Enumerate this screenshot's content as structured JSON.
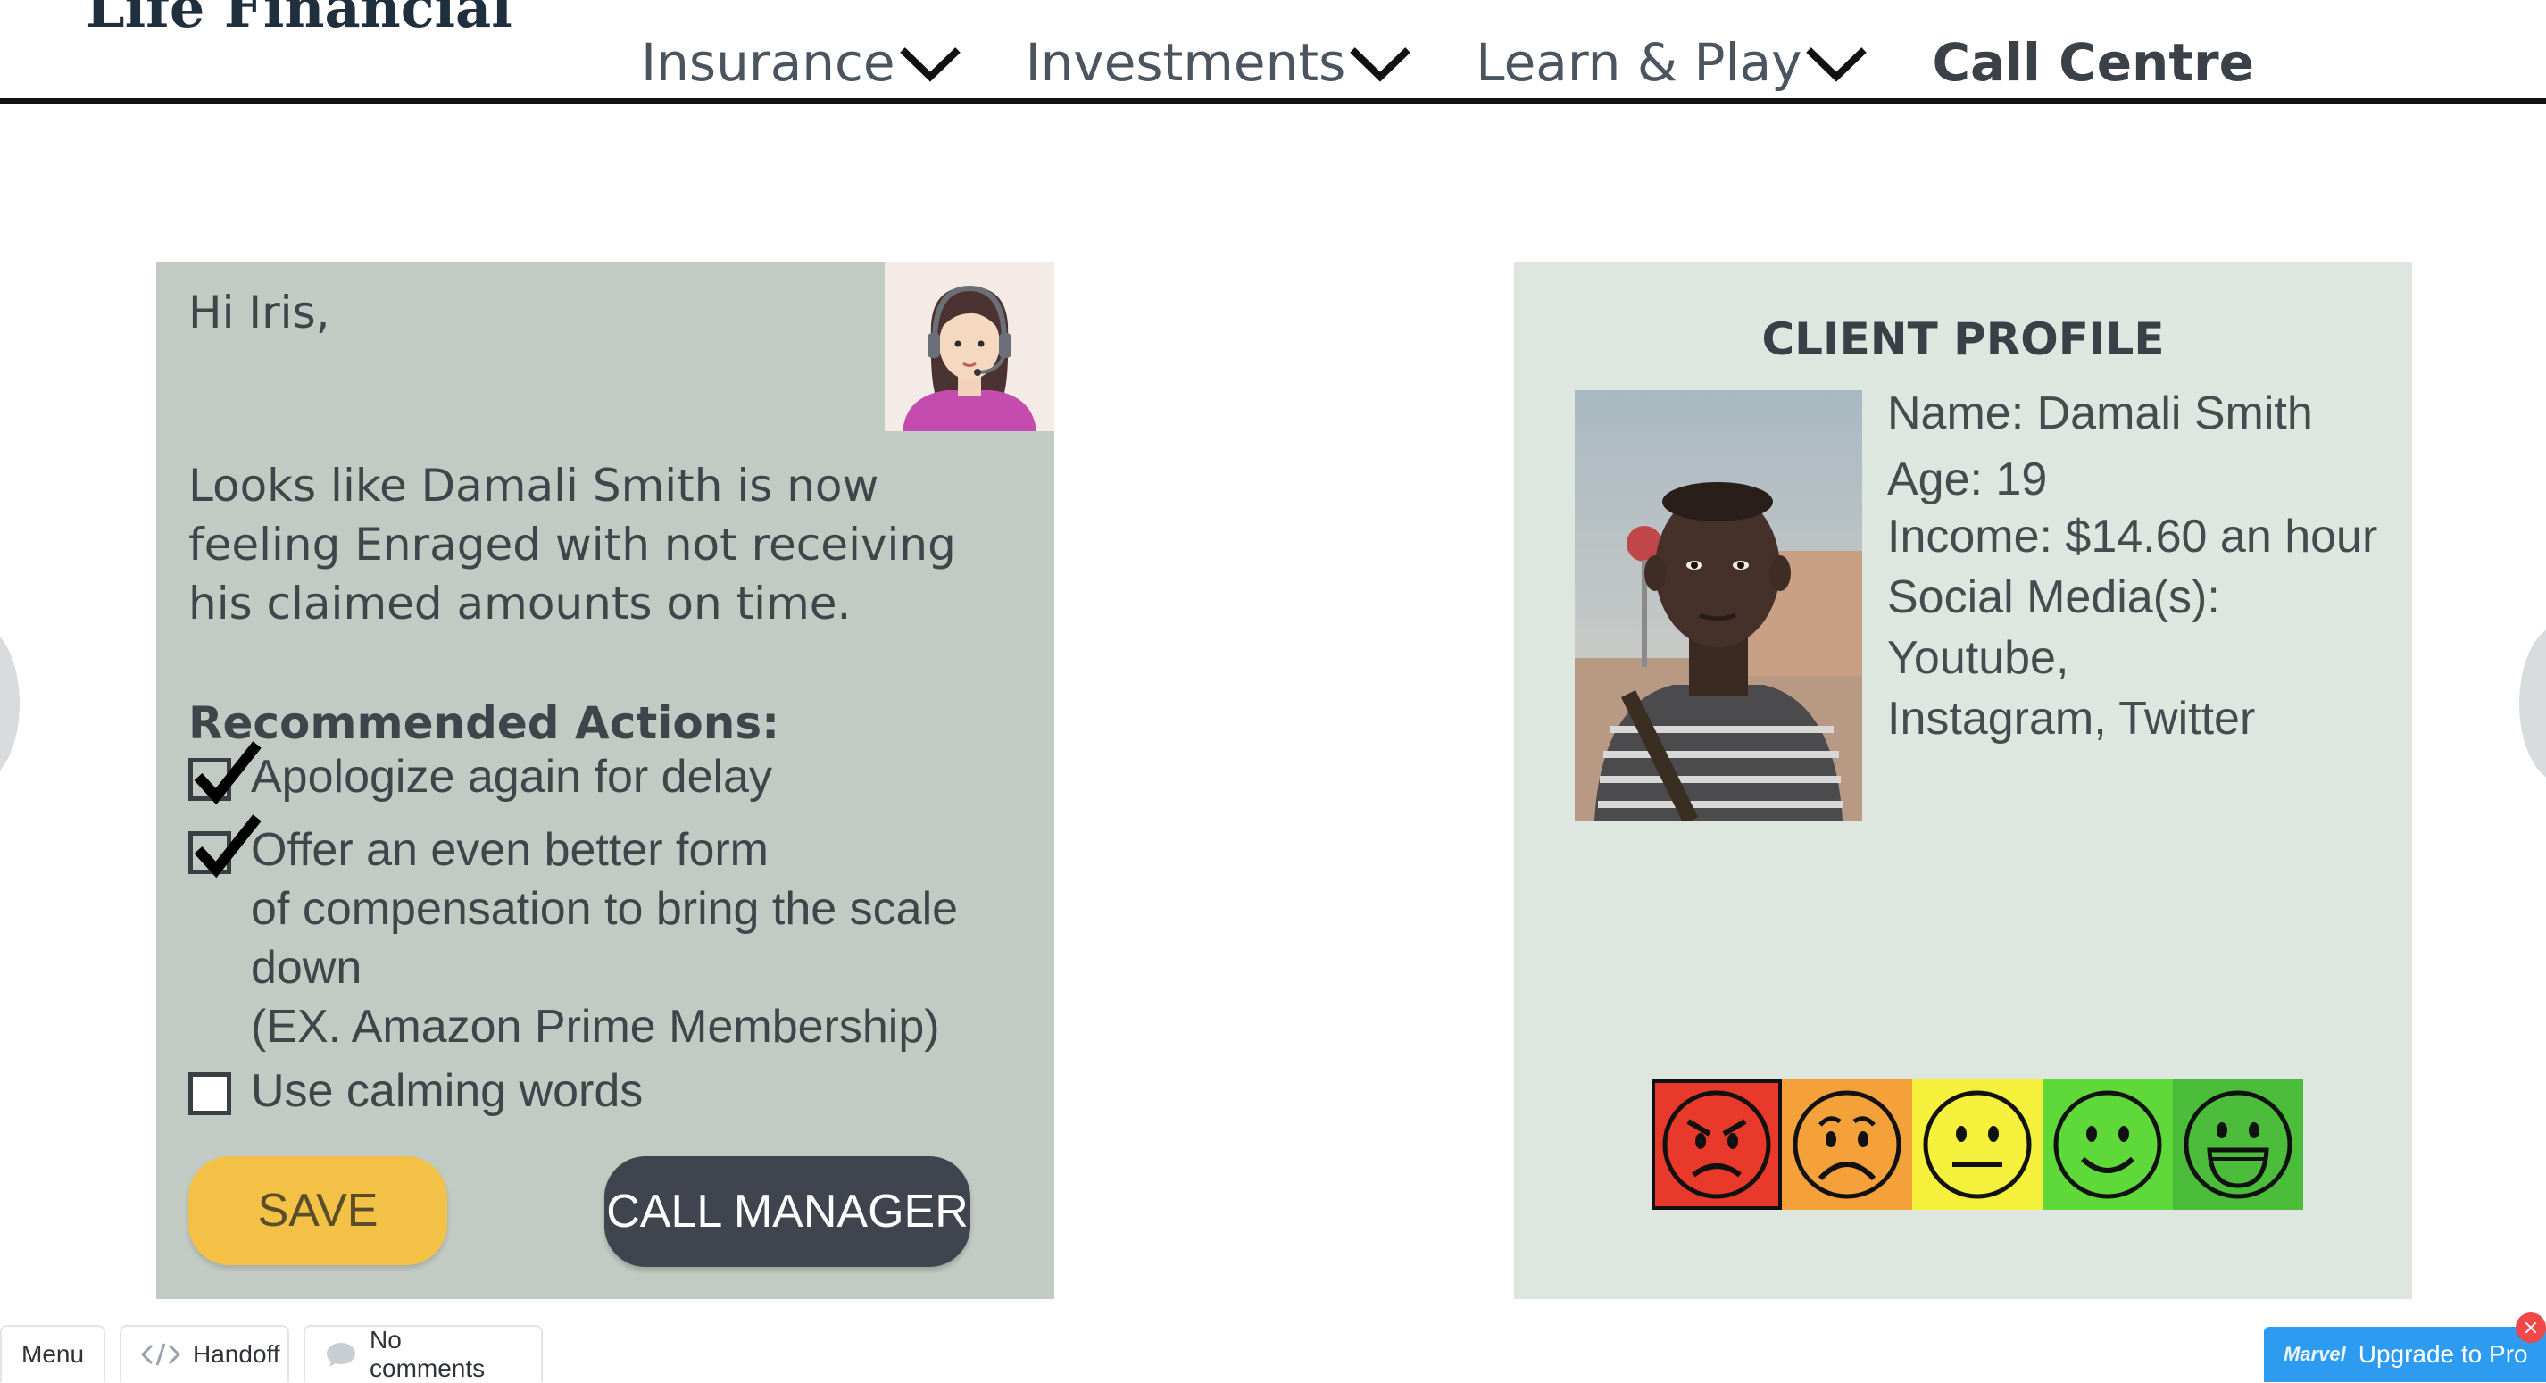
{
  "brand": {
    "name": "Life Financial"
  },
  "nav": {
    "items": [
      {
        "label": "Insurance"
      },
      {
        "label": "Investments"
      },
      {
        "label": "Learn & Play"
      },
      {
        "label": "Call Centre"
      }
    ]
  },
  "agent_panel": {
    "greeting": "Hi Iris,",
    "message": "Looks like Damali Smith is now feeling Enraged with not receiving his claimed amounts on time.",
    "recommended_title": "Recommended Actions:",
    "actions": [
      {
        "lines": [
          "Apologize again for delay"
        ],
        "checked": true
      },
      {
        "lines": [
          "Offer an even better form",
          "of compensation to bring the scale",
          "down",
          "(EX. Amazon Prime Membership)"
        ],
        "checked": true
      },
      {
        "lines": [
          "Use calming words"
        ],
        "checked": false
      }
    ],
    "save_label": "SAVE",
    "call_manager_label": "CALL MANAGER"
  },
  "client_profile": {
    "title": "CLIENT PROFILE",
    "name_line": "Name: Damali Smith",
    "age_line": "Age: 19",
    "income_line": "Income: $14.60 an hour",
    "social_line_1": "Social Media(s): Youtube,",
    "social_line_2": "Instagram, Twitter",
    "mood_scale": {
      "levels": [
        "angry",
        "sad",
        "neutral",
        "happy",
        "very-happy"
      ],
      "colors": [
        "#e8392a",
        "#f5a13a",
        "#f4f03c",
        "#5fd93a",
        "#4bbd3b"
      ],
      "selected": "angry"
    }
  },
  "toolbar": {
    "menu_label": "Menu",
    "handoff_label": "Handoff",
    "comments_label": "No comments",
    "upgrade_label": "Upgrade to Pro",
    "upgrade_brand": "Marvel"
  }
}
